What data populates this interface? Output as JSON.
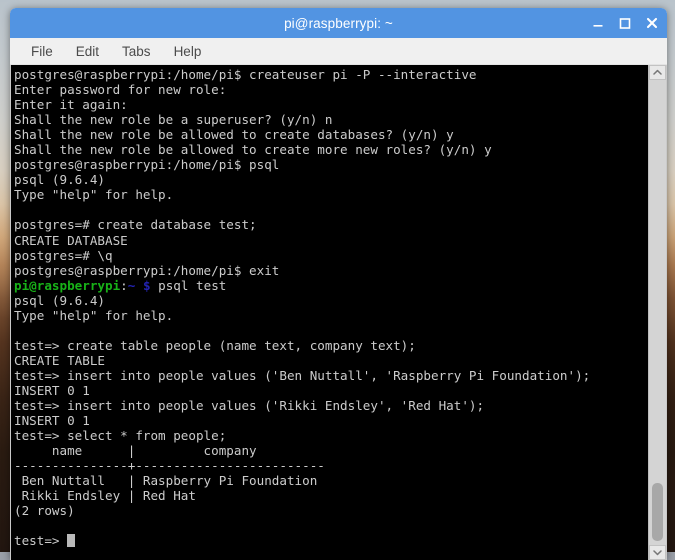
{
  "window": {
    "title": "pi@raspberrypi: ~",
    "controls": [
      {
        "name": "minimize",
        "glyph": "minimize-icon"
      },
      {
        "name": "maximize",
        "glyph": "maximize-icon"
      },
      {
        "name": "close",
        "glyph": "close-icon"
      }
    ],
    "accent_color": "#5294e2",
    "titlebar_text_color": "#ffffff"
  },
  "menubar": {
    "items": [
      {
        "label": "File"
      },
      {
        "label": "Edit"
      },
      {
        "label": "Tabs"
      },
      {
        "label": "Help"
      }
    ]
  },
  "terminal": {
    "background_color": "#000000",
    "foreground_color": "#cccccc",
    "prompt_user_color": "#18b218",
    "prompt_path_color": "#2323b2",
    "cursor_color": "#b9b9b9",
    "lines": [
      "postgres@raspberrypi:/home/pi$ createuser pi -P --interactive",
      "Enter password for new role:",
      "Enter it again:",
      "Shall the new role be a superuser? (y/n) n",
      "Shall the new role be allowed to create databases? (y/n) y",
      "Shall the new role be allowed to create more new roles? (y/n) y",
      "postgres@raspberrypi:/home/pi$ psql",
      "psql (9.6.4)",
      "Type \"help\" for help.",
      "",
      "postgres=# create database test;",
      "CREATE DATABASE",
      "postgres=# \\q",
      "postgres@raspberrypi:/home/pi$ exit",
      "__PROMPT__psql test",
      "psql (9.6.4)",
      "Type \"help\" for help.",
      "",
      "test=> create table people (name text, company text);",
      "CREATE TABLE",
      "test=> insert into people values ('Ben Nuttall', 'Raspberry Pi Foundation');",
      "INSERT 0 1",
      "test=> insert into people values ('Rikki Endsley', 'Red Hat');",
      "INSERT 0 1",
      "test=> select * from people;",
      "     name      |         company",
      "---------------+-------------------------",
      " Ben Nuttall   | Raspberry Pi Foundation",
      " Rikki Endsley | Red Hat",
      "(2 rows)",
      "",
      "__CURSOR__test=> "
    ],
    "prompt": {
      "user_host": "pi@raspberrypi",
      "separator": ":",
      "path": "~",
      "symbol": "$"
    },
    "query_result": {
      "columns": [
        "name",
        "company"
      ],
      "rows": [
        [
          "Ben Nuttall",
          "Raspberry Pi Foundation"
        ],
        [
          "Rikki Endsley",
          "Red Hat"
        ]
      ],
      "row_count_label": "(2 rows)"
    }
  },
  "scrollbar": {
    "up_arrow": "chevron-up-icon",
    "down_arrow": "chevron-down-icon",
    "thumb_position": "bottom"
  }
}
